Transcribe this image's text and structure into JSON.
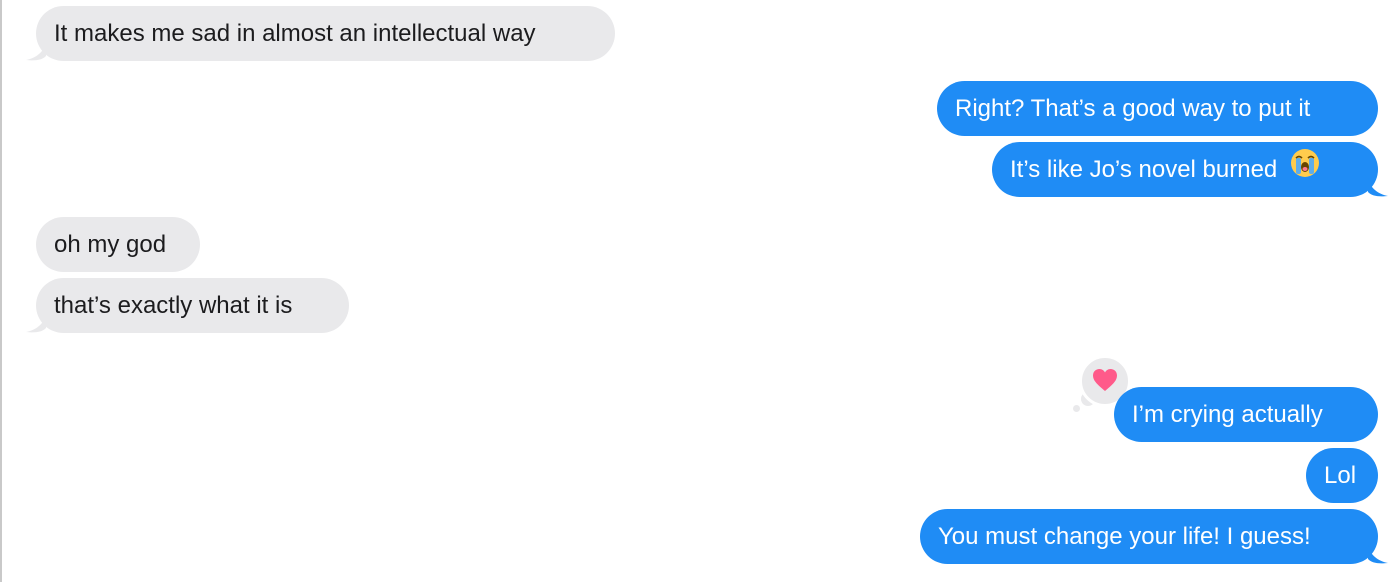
{
  "messages": [
    {
      "direction": "received",
      "text": "It makes me sad in almost an intellectual way"
    },
    {
      "direction": "sent",
      "text": "Right? That’s a good way to put it"
    },
    {
      "direction": "sent",
      "text": "It’s like Jo’s novel burned",
      "emoji": "😭"
    },
    {
      "direction": "received",
      "text": "oh my god"
    },
    {
      "direction": "received",
      "text": "that’s exactly what it is"
    },
    {
      "direction": "sent",
      "text": "I’m crying actually",
      "tapback": "heart-icon"
    },
    {
      "direction": "sent",
      "text": "Lol"
    },
    {
      "direction": "sent",
      "text": "You must change your life! I guess!"
    }
  ],
  "colors": {
    "sent_bubble": "#1f8cf5",
    "received_bubble": "#e9e9eb",
    "heart": "#ff5a8a"
  }
}
